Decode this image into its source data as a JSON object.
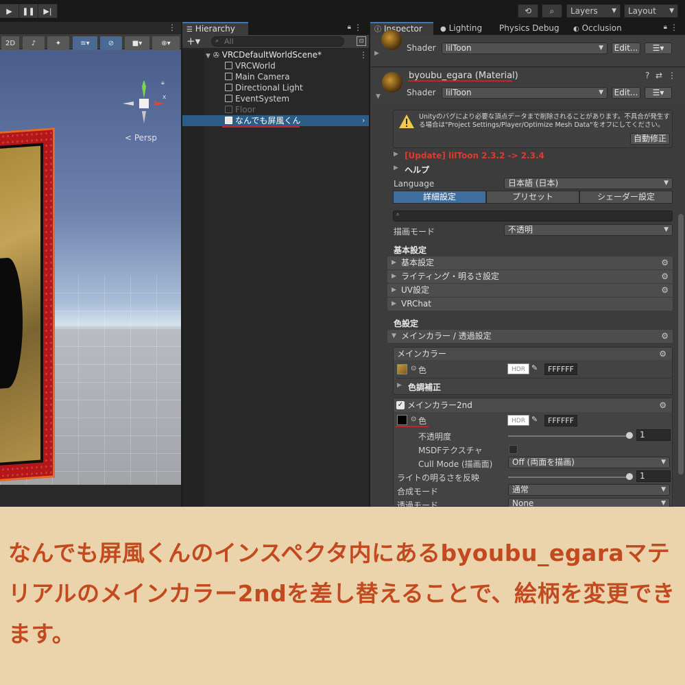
{
  "toolbar": {
    "layers_label": "Layers",
    "layout_label": "Layout"
  },
  "scene": {
    "btn_2d": "2D",
    "persp_label": "< Persp",
    "gizmo_axis_x": "x"
  },
  "hierarchy": {
    "tab_label": "Hierarchy",
    "search_placeholder": "All",
    "items": [
      {
        "label": "VRCDefaultWorldScene*"
      },
      {
        "label": "VRCWorld"
      },
      {
        "label": "Main Camera"
      },
      {
        "label": "Directional Light"
      },
      {
        "label": "EventSystem"
      },
      {
        "label": "Floor"
      },
      {
        "label": "なんでも屏風くん"
      }
    ]
  },
  "inspector": {
    "tabs": [
      "Inspector",
      "Lighting",
      "Physics Debug",
      "Occlusion"
    ],
    "top_shader_label": "Shader",
    "top_shader_value": "lilToon",
    "edit_label": "Edit...",
    "material_name": "byoubu_egara (Material)",
    "shader_label": "Shader",
    "shader_value": "lilToon",
    "warning_text": "Unityのバグにより必要な頂点データまで削除されることがあります。不具合が発生する場合は\"Project Settings/Player/Optimize Mesh Data\"をオフにしてください。",
    "auto_fix_label": "自動修正",
    "update_label": "[Update] lilToon 2.3.2 -> 2.3.4",
    "help_label": "ヘルプ",
    "language_label": "Language",
    "language_value": "日本語 (日本)",
    "mode_tabs": [
      "詳細設定",
      "プリセット",
      "シェーダー設定"
    ],
    "render_mode_label": "描画モード",
    "render_mode_value": "不透明",
    "basic_heading": "基本設定",
    "basic_sections": [
      "基本設定",
      "ライティング・明るさ設定",
      "UV設定",
      "VRChat"
    ],
    "color_heading": "色設定",
    "main_color_section": "メインカラー / 透過設定",
    "main_color_box_title": "メインカラー",
    "color_label": "色",
    "hdr_label": "HDR",
    "main_color_hex": "FFFFFF",
    "color_correction_label": "色調補正",
    "main2_title": "メインカラー2nd",
    "main2_hex": "FFFFFF",
    "opacity_label": "不透明度",
    "opacity_value": "1",
    "msdf_label": "MSDFテクスチャ",
    "cull_label": "Cull Mode (描画面)",
    "cull_value": "Off (両面を描画)",
    "light_reflect_label": "ライトの明るさを反映",
    "light_reflect_value": "1",
    "blend_label": "合成モード",
    "blend_value": "通常",
    "transparent_label": "透過モード",
    "transparent_value": "None"
  },
  "caption": {
    "text": "なんでも屏風くんのインスペクタ内にあるbyoubu_egaraマテリアルのメインカラー2ndを差し替えることで、絵柄を変更できます。"
  },
  "colors": {
    "accent": "#3a79bb",
    "selection": "#2c5d87",
    "highlight_underline": "#c8232b",
    "caption_bg": "#ebd3ac",
    "caption_text": "#c24a1e",
    "update_text": "#e03a2e"
  }
}
